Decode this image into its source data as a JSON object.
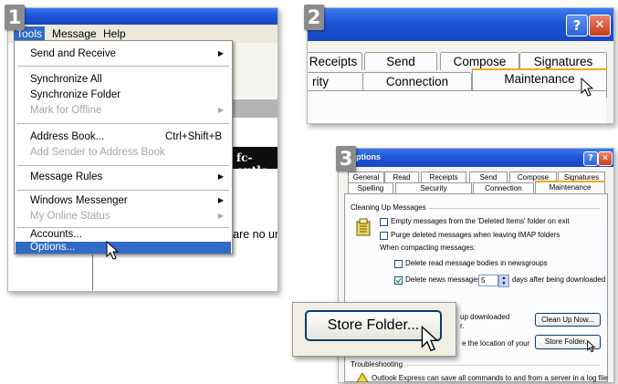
{
  "steps": [
    "1",
    "2",
    "3"
  ],
  "panel1": {
    "menubar": [
      "Tools",
      "Message",
      "Help"
    ],
    "menu": [
      {
        "label": "Send and Receive",
        "shortcut": "",
        "submenu": true,
        "disabled": false
      },
      {
        "label": "Synchronize All",
        "shortcut": "",
        "submenu": false,
        "disabled": false
      },
      {
        "label": "Synchronize Folder",
        "shortcut": "",
        "submenu": false,
        "disabled": false
      },
      {
        "label": "Mark for Offline",
        "shortcut": "",
        "submenu": true,
        "disabled": true
      },
      {
        "label": "Address Book...",
        "shortcut": "Ctrl+Shift+B",
        "submenu": false,
        "disabled": false
      },
      {
        "label": "Add Sender to Address Book",
        "shortcut": "",
        "submenu": false,
        "disabled": true
      },
      {
        "label": "Message Rules",
        "shortcut": "",
        "submenu": true,
        "disabled": false
      },
      {
        "label": "Windows Messenger",
        "shortcut": "",
        "submenu": true,
        "disabled": false
      },
      {
        "label": "My Online Status",
        "shortcut": "",
        "submenu": true,
        "disabled": true
      },
      {
        "label": "Accounts...",
        "shortcut": "",
        "submenu": false,
        "disabled": false
      },
      {
        "label": "Options...",
        "shortcut": "",
        "submenu": false,
        "disabled": false,
        "highlighted": true
      }
    ],
    "background_text": "fc-outlo",
    "background_message": "There are no un"
  },
  "panel2": {
    "help_glyph": "?",
    "close_glyph": "✕",
    "tabs_row1": [
      "Receipts",
      "Send",
      "Compose",
      "Signatures"
    ],
    "tabs_row2": [
      "rity",
      "Connection",
      "Maintenance"
    ],
    "active_tab": "Maintenance"
  },
  "panel3": {
    "title": "Options",
    "help_glyph": "?",
    "close_glyph": "✕",
    "tabs_row1": [
      "General",
      "Read",
      "Receipts",
      "Send",
      "Compose",
      "Signatures"
    ],
    "tabs_row2": [
      "Spelling",
      "Security",
      "Connection",
      "Maintenance"
    ],
    "group_title": "Cleaning Up Messages",
    "opt_empty": "Empty messages from the 'Deleted Items' folder on exit",
    "opt_purge": "Purge deleted messages when leaving IMAP folders",
    "compacting": "When compacting messages:",
    "opt_delete_read": "Delete read message bodies in newsgroups",
    "opt_delete_news": "Delete news messages",
    "days_value": "5",
    "days_after": "days after being downloaded",
    "cleanup_text_1": "up downloaded",
    "cleanup_text_2": "r.",
    "cleanup_button": "Clean Up Now...",
    "store_text": "e the location of your",
    "store_button": "Store Folder...",
    "troubleshooting": "Troubleshooting",
    "troubleshooting_text": "Outlook Express can save all commands to and from a server in a log file"
  },
  "zoom": {
    "store_button": "Store Folder..."
  }
}
